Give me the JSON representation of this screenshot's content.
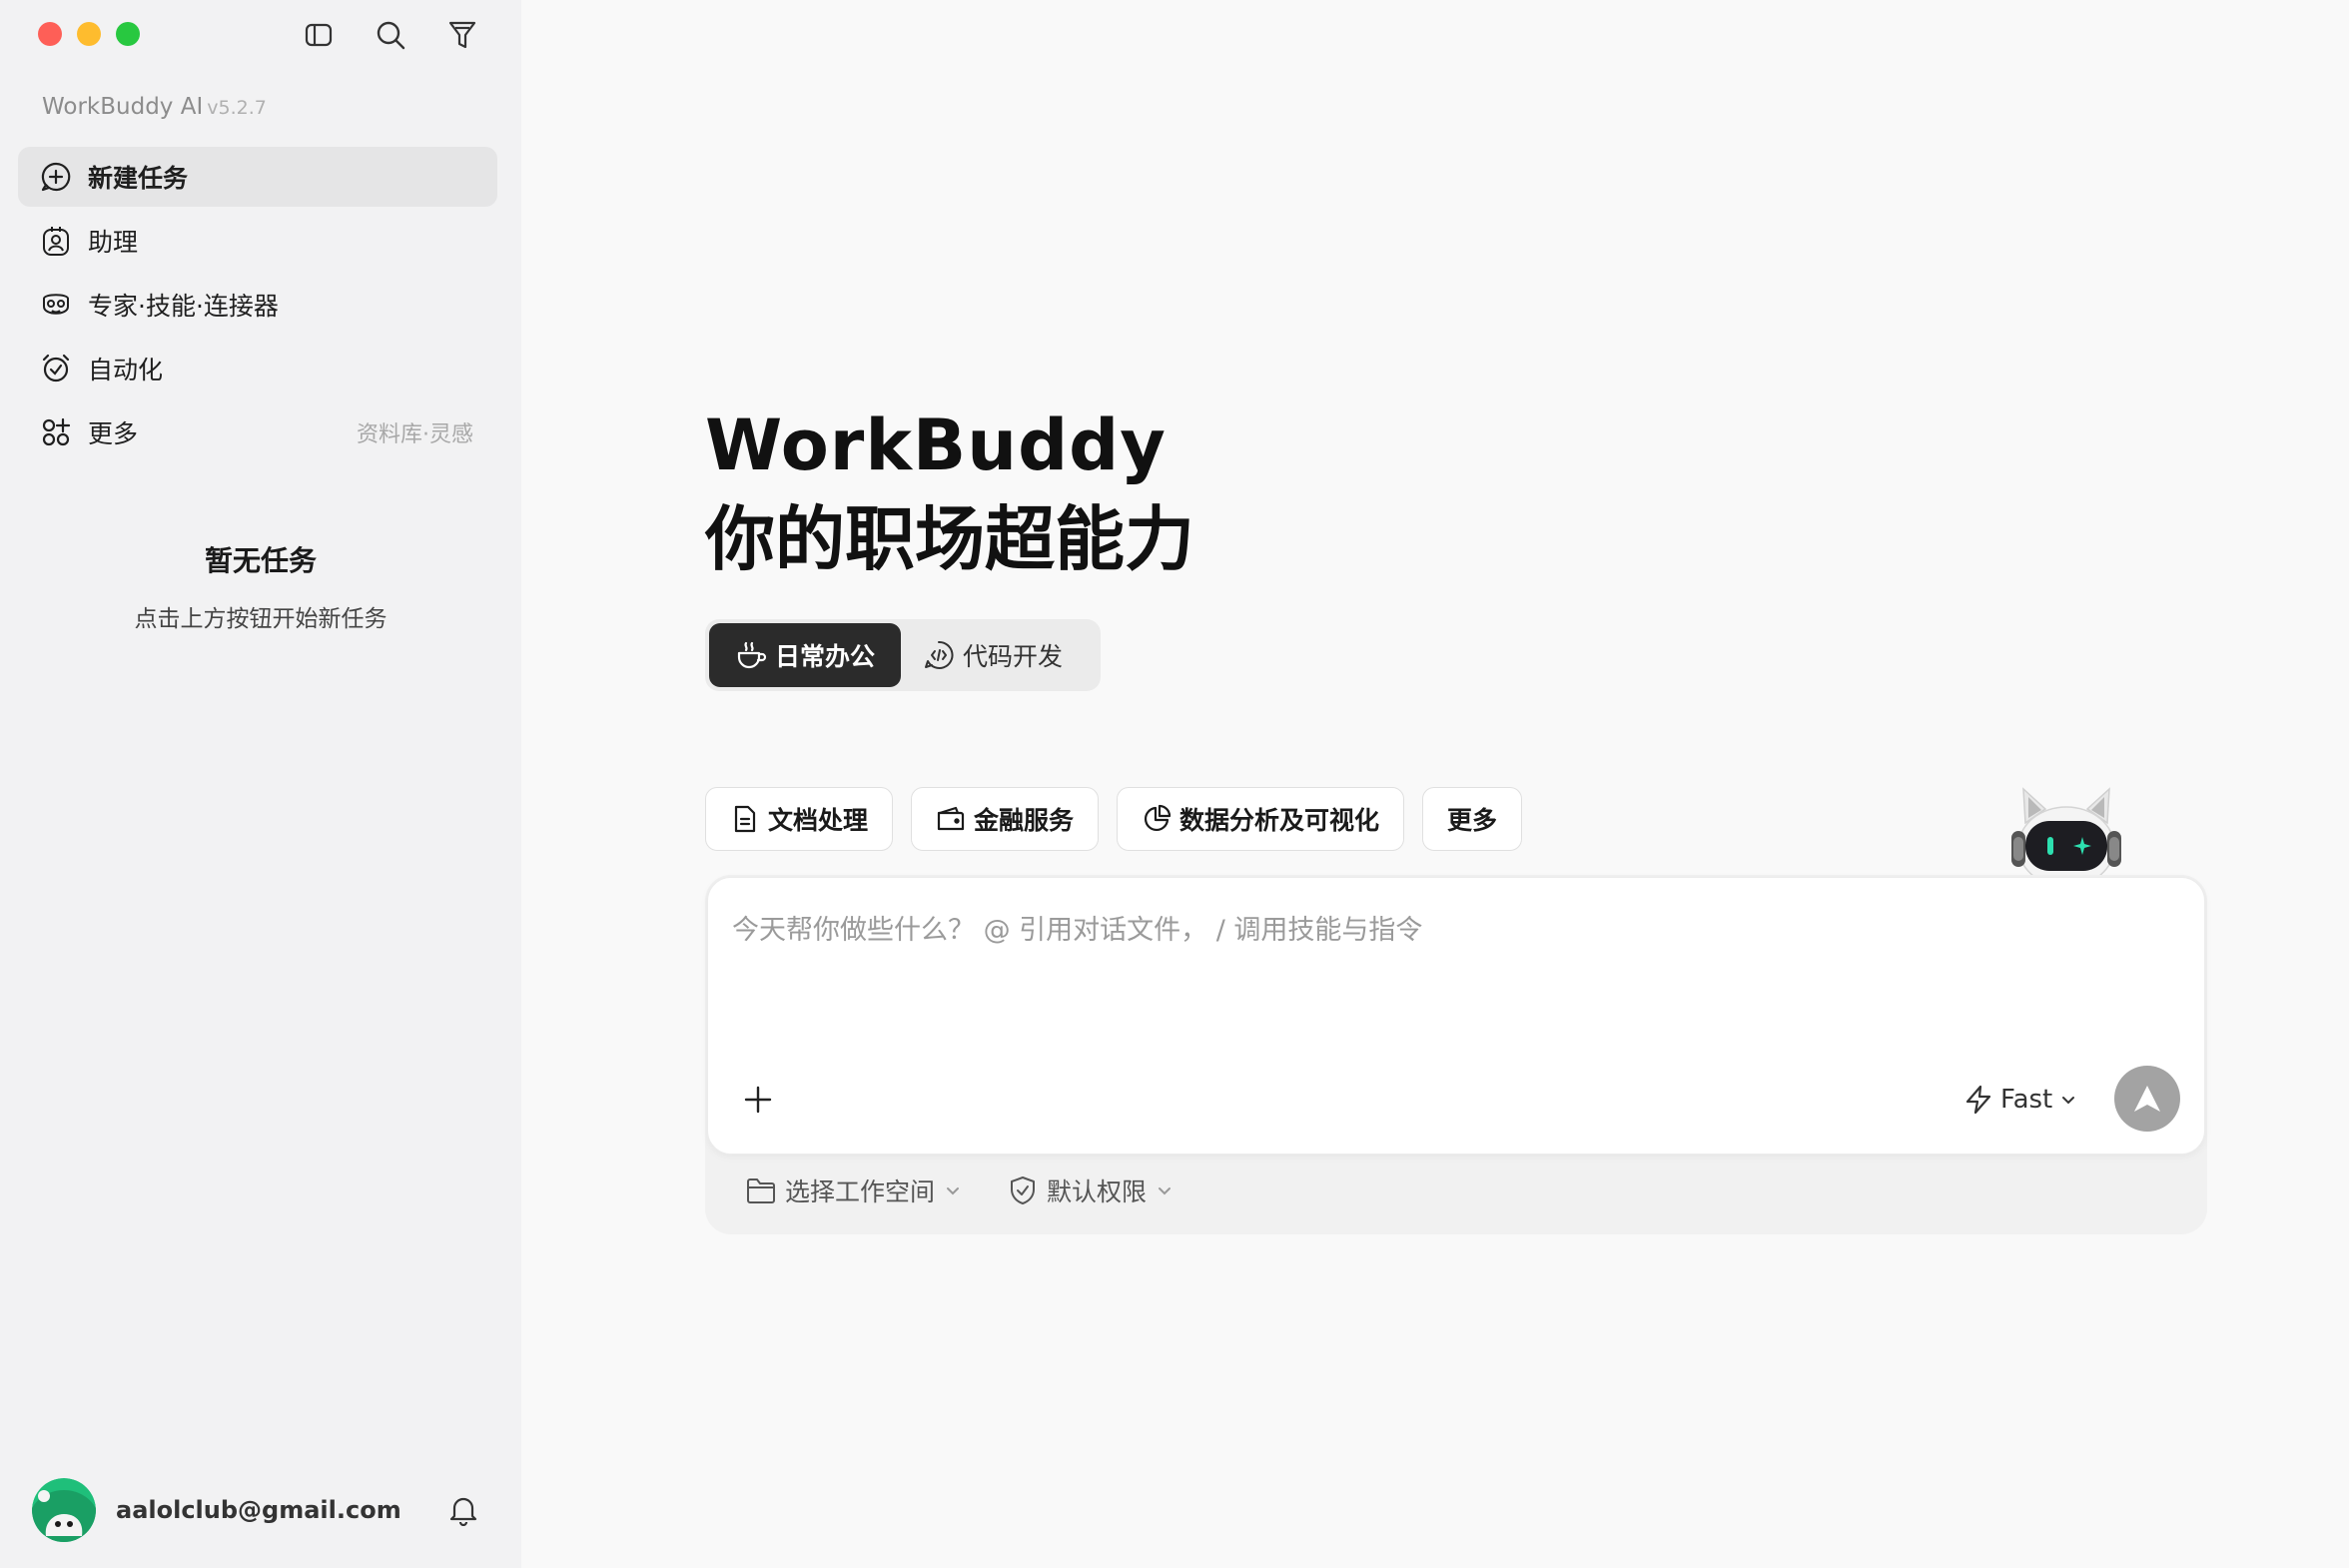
{
  "app": {
    "name": "WorkBuddy AI",
    "version": "v5.2.7"
  },
  "sidebar": {
    "nav": [
      {
        "label": "新建任务",
        "icon": "plus-chat-icon"
      },
      {
        "label": "助理",
        "icon": "assistant-icon"
      },
      {
        "label": "专家·技能·连接器",
        "icon": "expert-icon"
      },
      {
        "label": "自动化",
        "icon": "alarm-clock-icon"
      },
      {
        "label": "更多",
        "icon": "apps-icon",
        "hint": "资料库·灵感"
      }
    ],
    "empty_title": "暂无任务",
    "empty_subtitle": "点击上方按钮开始新任务",
    "user_email": "aalolclub@gmail.com"
  },
  "main": {
    "title": "WorkBuddy",
    "subtitle": "你的职场超能力",
    "modes": [
      {
        "label": "日常办公",
        "active": true
      },
      {
        "label": "代码开发",
        "active": false
      }
    ],
    "chips": [
      {
        "label": "文档处理"
      },
      {
        "label": "金融服务"
      },
      {
        "label": "数据分析及可视化"
      },
      {
        "label": "更多"
      }
    ],
    "input_placeholder": "今天帮你做些什么？ @ 引用对话文件， / 调用技能与指令",
    "model": "Fast",
    "workspace_label": "选择工作空间",
    "permission_label": "默认权限"
  },
  "colors": {
    "sidebar_bg": "#f2f2f3",
    "main_bg": "#f9f9f9",
    "active_mode_bg": "#2b2b2b",
    "send_btn": "#a3a3a3"
  }
}
